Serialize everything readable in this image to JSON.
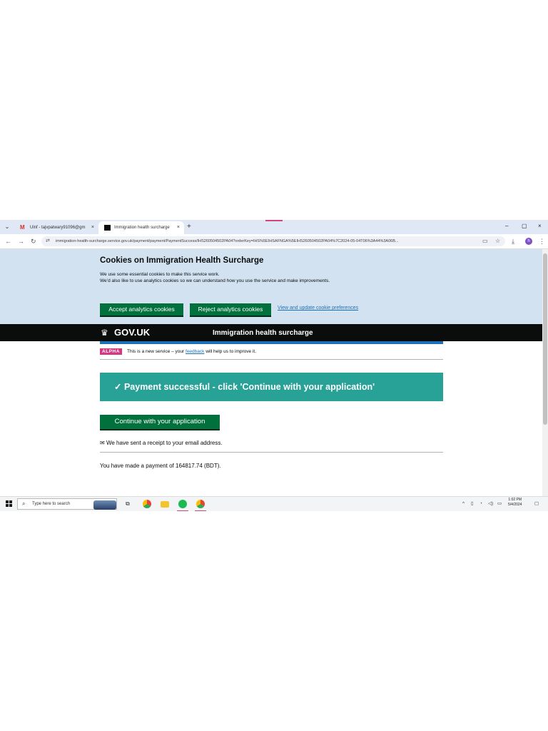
{
  "browser": {
    "tabs": [
      {
        "label": "Ulnf - tajvpatwary91096@gm",
        "favicon": "gmail-icon",
        "close": "×"
      },
      {
        "label": "Immigration health surcharge",
        "favicon": "govuk-icon",
        "close": "×"
      }
    ],
    "new_tab": "+",
    "window_controls": {
      "minimize": "–",
      "maximize": "▢",
      "close": "×"
    },
    "url": "immigration-health-surcharge.service.gov.uk/payment/payment/PaymentSuccess/IHS260504502PA04?orderKey=IHS%5EIHSAFNGA%5EIHS260504502PA04%7C2024-05-04T06%3A44%3A06B...",
    "avatar_letter": "h"
  },
  "cookie_banner": {
    "title": "Cookies on Immigration Health Surcharge",
    "line1": "We use some essential cookies to make this service work.",
    "line2": "We’d also like to use analytics cookies so we can understand how you use the service and make improvements.",
    "accept_label": "Accept analytics cookies",
    "reject_label": "Reject analytics cookies",
    "preferences_link": "View and update cookie preferences"
  },
  "header": {
    "logo_text": "GOV.UK",
    "service_name": "Immigration health surcharge"
  },
  "phase_banner": {
    "tag": "ALPHA",
    "text_before": "This is a new service – your ",
    "link": "feedback",
    "text_after": " will help us to improve it."
  },
  "main": {
    "success_message": "✓ Payment successful - click 'Continue with your application'",
    "continue_label": "Continue with your application",
    "receipt_text": "We have sent a receipt to your email address.",
    "payment_text": "You have made a payment of 164817.74 (BDT)."
  },
  "taskbar": {
    "search_placeholder": "Type here to search",
    "time": "1:02 PM",
    "date": "5/4/2024"
  },
  "colors": {
    "govuk_green": "#00703c",
    "success_panel": "#28a197",
    "govuk_blue": "#1d70b8",
    "alpha_pink": "#d53880",
    "cookie_bg": "#d2e2f1"
  }
}
